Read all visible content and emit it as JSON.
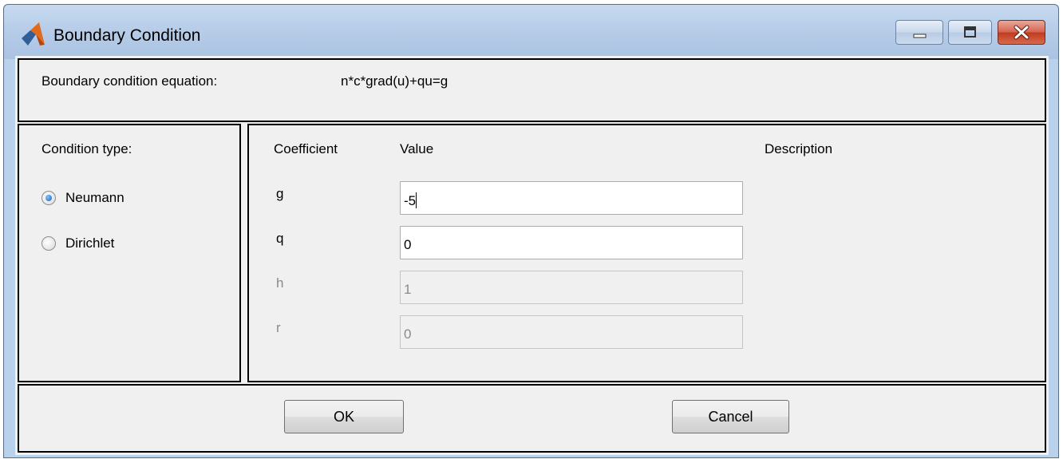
{
  "window": {
    "title": "Boundary Condition"
  },
  "equation": {
    "label": "Boundary condition equation:",
    "value": "n*c*grad(u)+qu=g"
  },
  "condition": {
    "label": "Condition type:",
    "options": [
      {
        "label": "Neumann",
        "checked": true
      },
      {
        "label": "Dirichlet",
        "checked": false
      }
    ]
  },
  "table": {
    "headers": {
      "coefficient": "Coefficient",
      "value": "Value",
      "description": "Description"
    },
    "rows": [
      {
        "name": "g",
        "value": "-5",
        "enabled": true,
        "focused": true
      },
      {
        "name": "q",
        "value": "0",
        "enabled": true
      },
      {
        "name": "h",
        "value": "1",
        "enabled": false
      },
      {
        "name": "r",
        "value": "0",
        "enabled": false
      }
    ]
  },
  "buttons": {
    "ok": "OK",
    "cancel": "Cancel"
  },
  "colors": {
    "titlebar": "#b9d1ea",
    "dialog_bg": "#f0f0f0",
    "close": "#c2391f",
    "radio_dot": "#1a5fb4"
  }
}
